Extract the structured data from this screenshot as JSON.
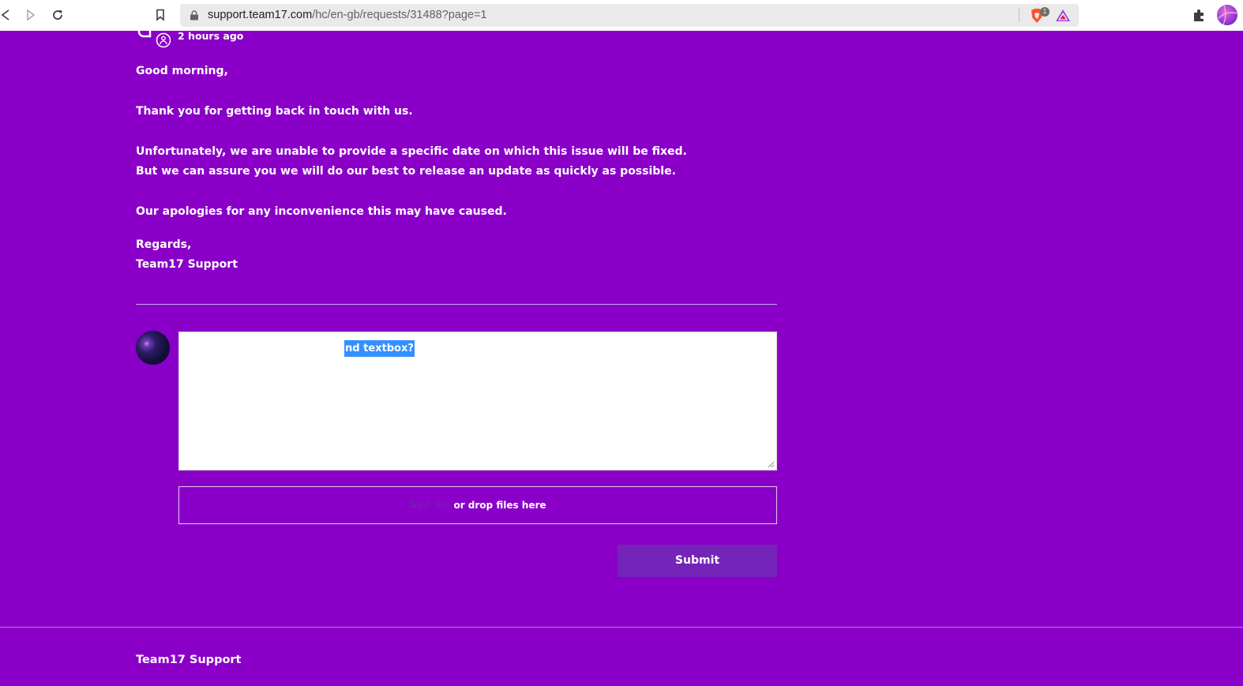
{
  "browser": {
    "url_host": "support.team17.com",
    "url_path": "/hc/en-gb/requests/31488?page=1",
    "shield_count": "1"
  },
  "comment": {
    "time_ago": "2 hours ago",
    "lines": [
      "Good morning,",
      "Thank you for getting back in touch with us.",
      "Unfortunately, we are unable to provide a specific date on which this issue will be fixed.",
      "But we can assure you we will do our best to release an update as quickly as possible.",
      "Our apologies for any inconvenience this may have caused.",
      "Regards,",
      "Team17 Support"
    ]
  },
  "reply": {
    "selected_text": "nd textbox?"
  },
  "attachments": {
    "add_file_label": "Add file",
    "drop_label": "or drop files here"
  },
  "actions": {
    "submit_label": "Submit"
  },
  "footer": {
    "title": "Team17 Support"
  },
  "colors": {
    "page_background": "#8a00c8",
    "submit_background": "#7424b8",
    "selection_highlight": "#3390ff"
  }
}
